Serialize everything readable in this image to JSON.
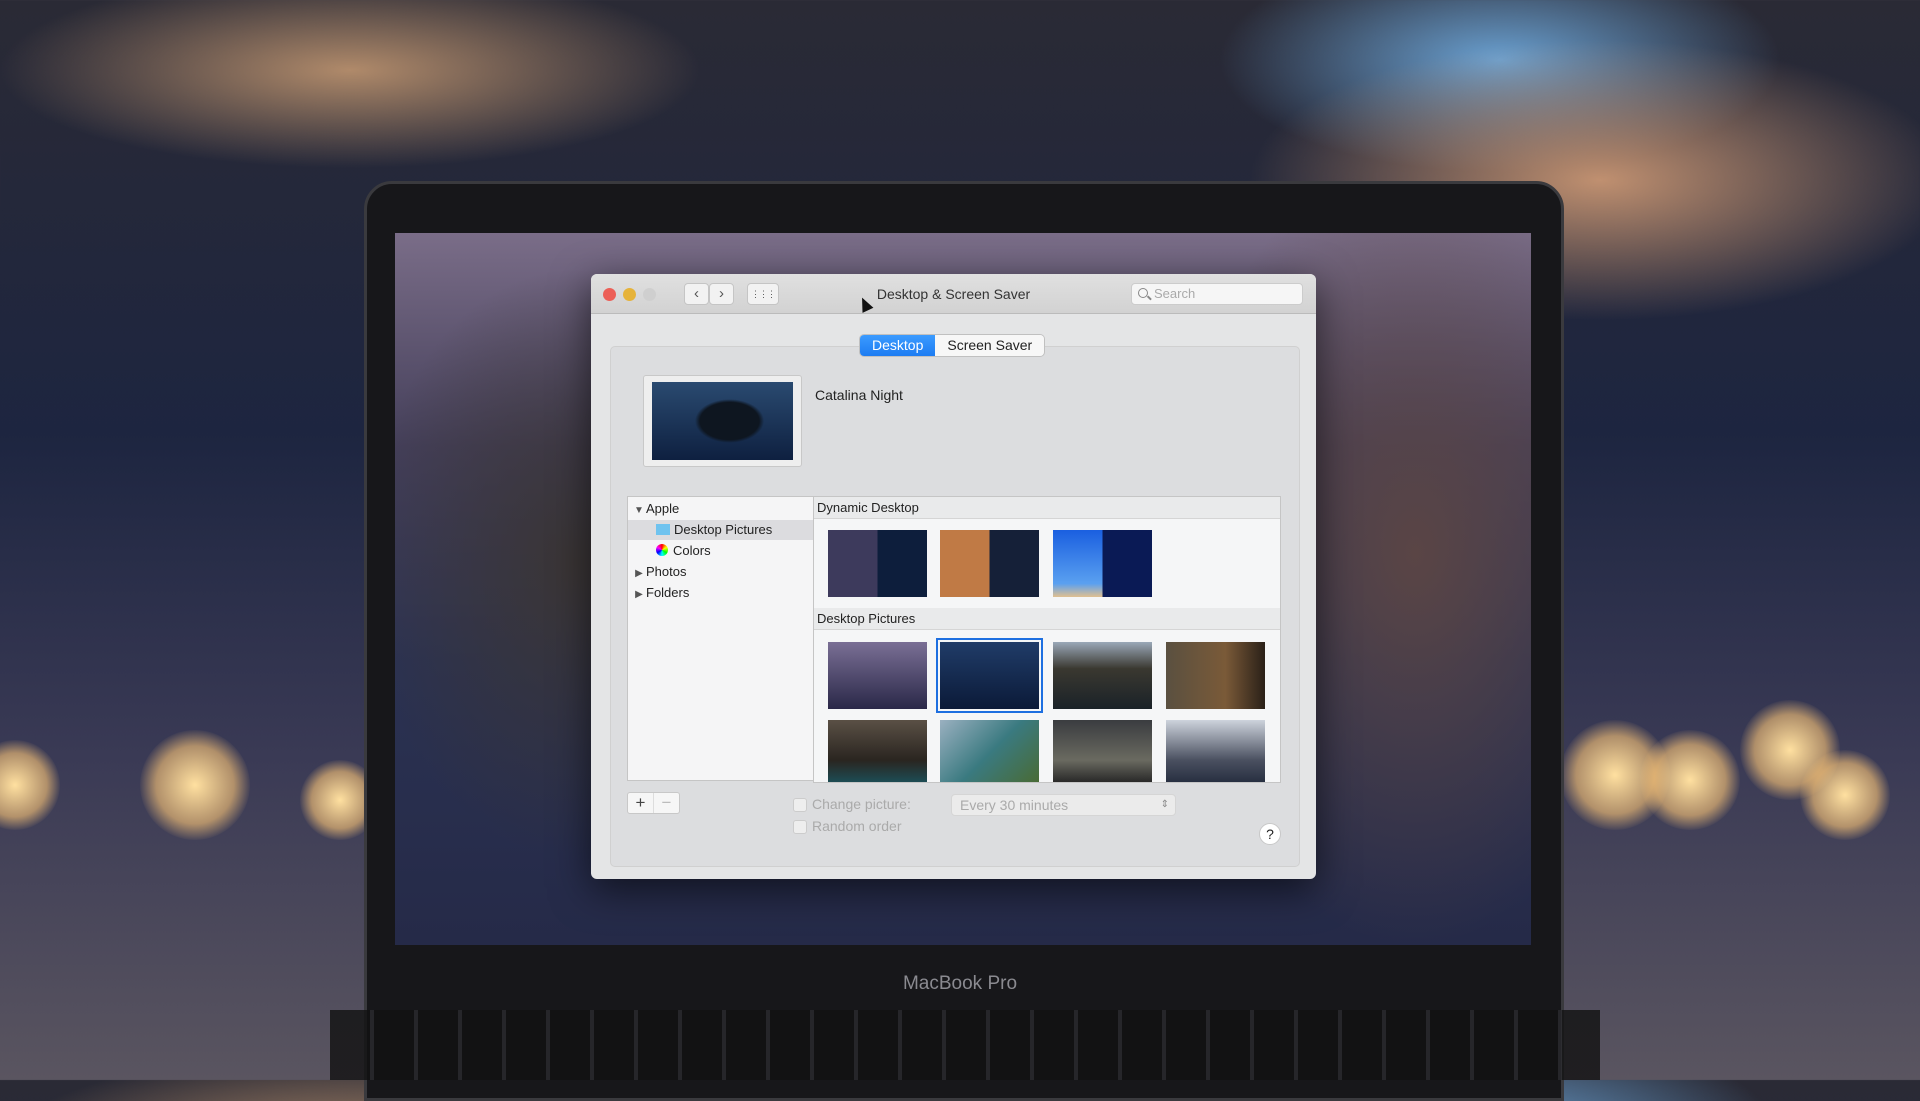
{
  "window": {
    "title": "Desktop & Screen Saver",
    "search_placeholder": "Search",
    "back": "‹",
    "forward": "›",
    "grid": "⋮⋮⋮"
  },
  "tabs": [
    {
      "label": "Desktop",
      "active": true
    },
    {
      "label": "Screen Saver",
      "active": false
    }
  ],
  "current_picture": {
    "name": "Catalina Night"
  },
  "source_list": [
    {
      "label": "Apple",
      "expander": "▼",
      "level": 0
    },
    {
      "label": "Desktop Pictures",
      "level": 1,
      "selected": true
    },
    {
      "label": "Colors",
      "level": 1
    },
    {
      "label": "Photos",
      "expander": "▶",
      "level": 0
    },
    {
      "label": "Folders",
      "expander": "▶",
      "level": 0
    }
  ],
  "sections": {
    "dynamic": "Dynamic Desktop",
    "pictures": "Desktop Pictures"
  },
  "controls": {
    "add": "+",
    "remove": "−",
    "change_picture": "Change picture:",
    "interval": "Every 30 minutes",
    "random_order": "Random order",
    "help": "?"
  },
  "device": {
    "brand": "MacBook Pro"
  },
  "colors": {
    "accent": "#1d7cf2",
    "close": "#ec5f57",
    "minimize": "#e6b33a"
  }
}
